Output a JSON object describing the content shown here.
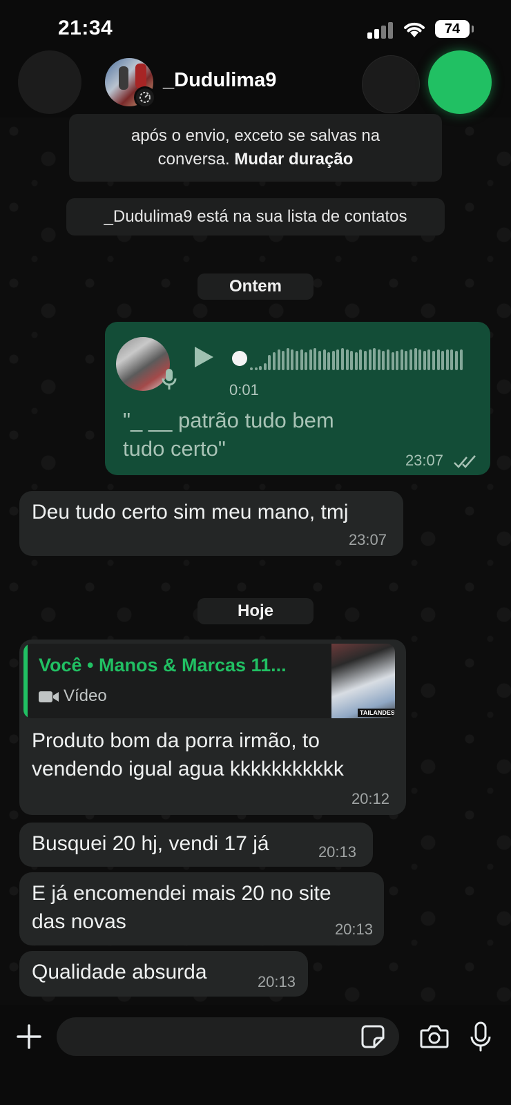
{
  "status_bar": {
    "time": "21:34",
    "battery": "74"
  },
  "header": {
    "contact_name": "_Dudulima9"
  },
  "notices": {
    "disappearing_line1": "após o envio, exceto se salvas na",
    "disappearing_line2_prefix": "conversa.",
    "disappearing_link": "Mudar duração",
    "contact_notice": "_Dudulima9 está na sua lista de contatos"
  },
  "dates": {
    "yesterday": "Ontem",
    "today": "Hoje"
  },
  "messages": {
    "voice": {
      "duration": "0:01",
      "transcript_line1": "\"_ __ patrão tudo bem",
      "transcript_line2": "tudo certo\"",
      "time": "23:07"
    },
    "m1": {
      "text": "Deu tudo certo sim meu mano, tmj",
      "time": "23:07"
    },
    "m2": {
      "quote_title": "Você • Manos & Marcas 11...",
      "quote_type": "Vídeo",
      "thumb_label": "TAILANDESA",
      "text_line1": "Produto bom da porra irmão, to",
      "text_line2": "vendendo igual agua kkkkkkkkkkk",
      "time": "20:12"
    },
    "m3": {
      "text": "Busquei 20 hj, vendi 17 já",
      "time": "20:13"
    },
    "m4": {
      "text_line1": "E já encomendei mais 20 no site",
      "text_line2": "das novas",
      "time": "20:13"
    },
    "m5": {
      "text": "Qualidade absurda",
      "time": "20:13"
    }
  },
  "colors": {
    "accent": "#21c063",
    "outgoing_bubble": "#134d37",
    "incoming_bubble": "#242626"
  },
  "icons": [
    "back-icon",
    "video-call-icon",
    "voice-call-icon",
    "play-icon",
    "mic-icon",
    "plus-icon",
    "sticker-icon",
    "camera-icon",
    "double-check-icon"
  ]
}
